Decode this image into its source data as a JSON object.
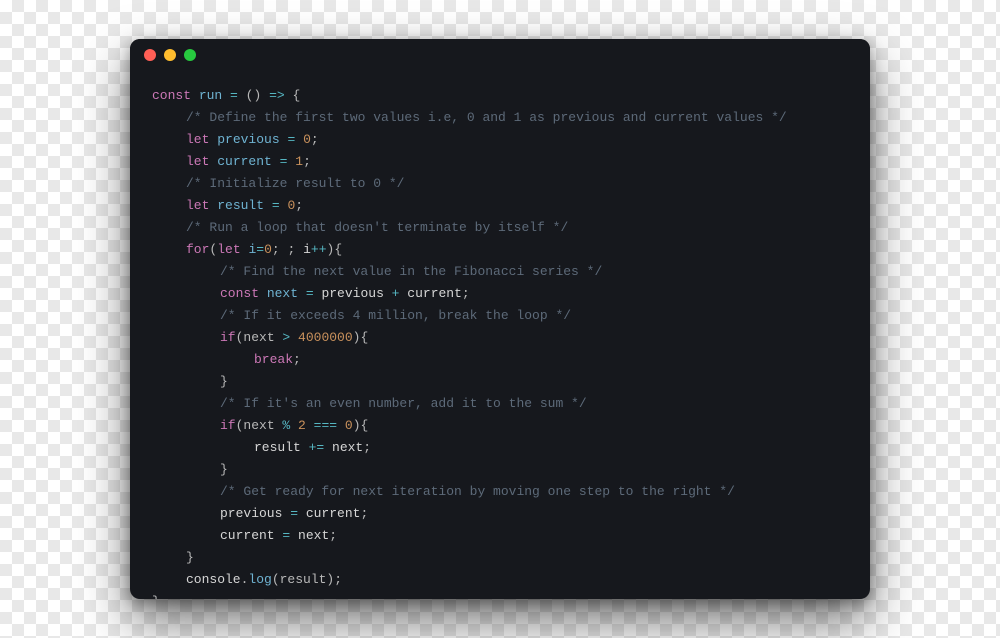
{
  "window": {
    "traffic_lights": [
      "close",
      "minimize",
      "zoom"
    ]
  },
  "code": {
    "lines": [
      {
        "indent": 0,
        "tokens": [
          {
            "t": "const ",
            "c": "tok-dcl"
          },
          {
            "t": "run",
            "c": "tok-fn"
          },
          {
            "t": " ",
            "c": "tok-punc"
          },
          {
            "t": "=",
            "c": "tok-op"
          },
          {
            "t": " () ",
            "c": "tok-punc"
          },
          {
            "t": "=>",
            "c": "tok-op"
          },
          {
            "t": " {",
            "c": "tok-punc"
          }
        ]
      },
      {
        "indent": 1,
        "tokens": [
          {
            "t": "/* Define the first two values i.e, 0 and 1 as previous and current values */",
            "c": "tok-cmt"
          }
        ]
      },
      {
        "indent": 1,
        "tokens": [
          {
            "t": "let ",
            "c": "tok-dcl"
          },
          {
            "t": "previous",
            "c": "tok-prop"
          },
          {
            "t": " ",
            "c": "tok-punc"
          },
          {
            "t": "=",
            "c": "tok-op"
          },
          {
            "t": " ",
            "c": "tok-punc"
          },
          {
            "t": "0",
            "c": "tok-num"
          },
          {
            "t": ";",
            "c": "tok-punc"
          }
        ]
      },
      {
        "indent": 1,
        "tokens": [
          {
            "t": "let ",
            "c": "tok-dcl"
          },
          {
            "t": "current",
            "c": "tok-prop"
          },
          {
            "t": " ",
            "c": "tok-punc"
          },
          {
            "t": "=",
            "c": "tok-op"
          },
          {
            "t": " ",
            "c": "tok-punc"
          },
          {
            "t": "1",
            "c": "tok-num"
          },
          {
            "t": ";",
            "c": "tok-punc"
          }
        ]
      },
      {
        "indent": 1,
        "tokens": [
          {
            "t": "/* Initialize result to 0 */",
            "c": "tok-cmt"
          }
        ]
      },
      {
        "indent": 1,
        "tokens": [
          {
            "t": "let ",
            "c": "tok-dcl"
          },
          {
            "t": "result",
            "c": "tok-prop"
          },
          {
            "t": " ",
            "c": "tok-punc"
          },
          {
            "t": "=",
            "c": "tok-op"
          },
          {
            "t": " ",
            "c": "tok-punc"
          },
          {
            "t": "0",
            "c": "tok-num"
          },
          {
            "t": ";",
            "c": "tok-punc"
          }
        ]
      },
      {
        "indent": 1,
        "tokens": [
          {
            "t": "/* Run a loop that doesn't terminate by itself */",
            "c": "tok-cmt"
          }
        ]
      },
      {
        "indent": 1,
        "tokens": [
          {
            "t": "for",
            "c": "tok-kw"
          },
          {
            "t": "(",
            "c": "tok-punc"
          },
          {
            "t": "let ",
            "c": "tok-dcl"
          },
          {
            "t": "i",
            "c": "tok-prop"
          },
          {
            "t": "=",
            "c": "tok-op"
          },
          {
            "t": "0",
            "c": "tok-num"
          },
          {
            "t": "; ; ",
            "c": "tok-punc"
          },
          {
            "t": "i",
            "c": "tok-var"
          },
          {
            "t": "++",
            "c": "tok-op"
          },
          {
            "t": "){",
            "c": "tok-punc"
          }
        ]
      },
      {
        "indent": 2,
        "tokens": [
          {
            "t": "/* Find the next value in the Fibonacci series */",
            "c": "tok-cmt"
          }
        ]
      },
      {
        "indent": 2,
        "tokens": [
          {
            "t": "const ",
            "c": "tok-dcl"
          },
          {
            "t": "next",
            "c": "tok-prop"
          },
          {
            "t": " ",
            "c": "tok-punc"
          },
          {
            "t": "=",
            "c": "tok-op"
          },
          {
            "t": " previous ",
            "c": "tok-var"
          },
          {
            "t": "+",
            "c": "tok-op"
          },
          {
            "t": " current",
            "c": "tok-var"
          },
          {
            "t": ";",
            "c": "tok-punc"
          }
        ]
      },
      {
        "indent": 2,
        "tokens": [
          {
            "t": "/* If it exceeds 4 million, break the loop */",
            "c": "tok-cmt"
          }
        ]
      },
      {
        "indent": 2,
        "tokens": [
          {
            "t": "if",
            "c": "tok-kw"
          },
          {
            "t": "(next ",
            "c": "tok-punc"
          },
          {
            "t": ">",
            "c": "tok-op"
          },
          {
            "t": " ",
            "c": "tok-punc"
          },
          {
            "t": "4000000",
            "c": "tok-num"
          },
          {
            "t": "){",
            "c": "tok-punc"
          }
        ]
      },
      {
        "indent": 3,
        "tokens": [
          {
            "t": "break",
            "c": "tok-kw"
          },
          {
            "t": ";",
            "c": "tok-punc"
          }
        ]
      },
      {
        "indent": 2,
        "tokens": [
          {
            "t": "}",
            "c": "tok-punc"
          }
        ]
      },
      {
        "indent": 2,
        "tokens": [
          {
            "t": "/* If it's an even number, add it to the sum */",
            "c": "tok-cmt"
          }
        ]
      },
      {
        "indent": 2,
        "tokens": [
          {
            "t": "if",
            "c": "tok-kw"
          },
          {
            "t": "(next ",
            "c": "tok-punc"
          },
          {
            "t": "%",
            "c": "tok-op"
          },
          {
            "t": " ",
            "c": "tok-punc"
          },
          {
            "t": "2",
            "c": "tok-num"
          },
          {
            "t": " ",
            "c": "tok-punc"
          },
          {
            "t": "===",
            "c": "tok-op"
          },
          {
            "t": " ",
            "c": "tok-punc"
          },
          {
            "t": "0",
            "c": "tok-num"
          },
          {
            "t": "){",
            "c": "tok-punc"
          }
        ]
      },
      {
        "indent": 3,
        "tokens": [
          {
            "t": "result ",
            "c": "tok-var"
          },
          {
            "t": "+=",
            "c": "tok-op"
          },
          {
            "t": " next",
            "c": "tok-var"
          },
          {
            "t": ";",
            "c": "tok-punc"
          }
        ]
      },
      {
        "indent": 2,
        "tokens": [
          {
            "t": "}",
            "c": "tok-punc"
          }
        ]
      },
      {
        "indent": 2,
        "tokens": [
          {
            "t": "/* Get ready for next iteration by moving one step to the right */",
            "c": "tok-cmt"
          }
        ]
      },
      {
        "indent": 2,
        "tokens": [
          {
            "t": "previous ",
            "c": "tok-var"
          },
          {
            "t": "=",
            "c": "tok-op"
          },
          {
            "t": " current",
            "c": "tok-var"
          },
          {
            "t": ";",
            "c": "tok-punc"
          }
        ]
      },
      {
        "indent": 2,
        "tokens": [
          {
            "t": "current ",
            "c": "tok-var"
          },
          {
            "t": "=",
            "c": "tok-op"
          },
          {
            "t": " next",
            "c": "tok-var"
          },
          {
            "t": ";",
            "c": "tok-punc"
          }
        ]
      },
      {
        "indent": 1,
        "tokens": [
          {
            "t": "}",
            "c": "tok-punc"
          }
        ]
      },
      {
        "indent": 1,
        "tokens": [
          {
            "t": "console",
            "c": "tok-var"
          },
          {
            "t": ".",
            "c": "tok-punc"
          },
          {
            "t": "log",
            "c": "tok-fn"
          },
          {
            "t": "(result)",
            "c": "tok-punc"
          },
          {
            "t": ";",
            "c": "tok-punc"
          }
        ]
      },
      {
        "indent": 0,
        "tokens": [
          {
            "t": "}",
            "c": "tok-punc"
          }
        ]
      }
    ]
  }
}
